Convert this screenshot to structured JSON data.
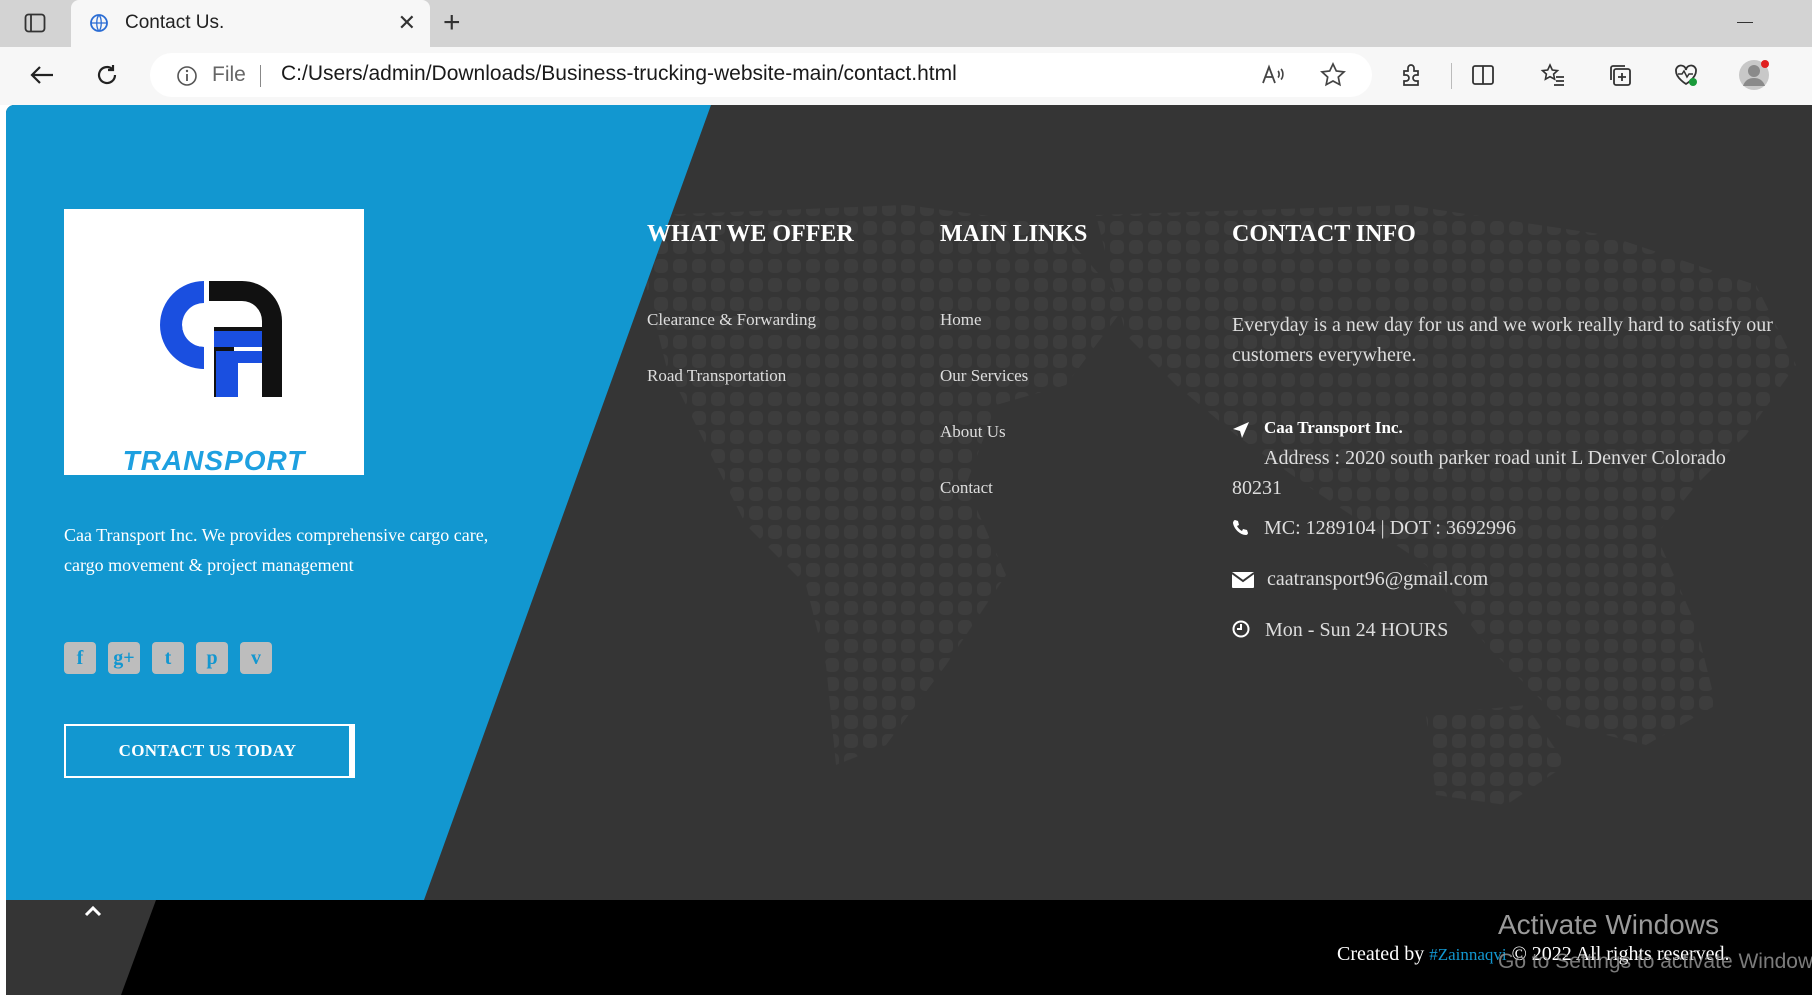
{
  "browser": {
    "tab_title": "Contact Us.",
    "address_scheme": "File",
    "address_url": "C:/Users/admin/Downloads/Business-trucking-website-main/contact.html"
  },
  "logo": {
    "letters": "CAA",
    "wordmark": "TRANSPORT"
  },
  "about": {
    "text": "Caa Transport Inc. We provides comprehensive cargo care, cargo movement & project management"
  },
  "socials": [
    {
      "icon": "facebook-icon",
      "glyph": "f"
    },
    {
      "icon": "google-plus-icon",
      "glyph": "g+"
    },
    {
      "icon": "twitter-icon",
      "glyph": "t"
    },
    {
      "icon": "pinterest-icon",
      "glyph": "p"
    },
    {
      "icon": "vimeo-icon",
      "glyph": "v"
    }
  ],
  "cta": {
    "label": "CONTACT US TODAY"
  },
  "offer": {
    "heading": "WHAT WE OFFER",
    "links": [
      "Clearance & Forwarding",
      "Road Transportation"
    ]
  },
  "main_links": {
    "heading": "MAIN LINKS",
    "links": [
      "Home",
      "Our Services",
      "About Us",
      "Contact"
    ]
  },
  "contact_info": {
    "heading": "CONTACT INFO",
    "intro": "Everyday is a new day for us and we work really hard to satisfy our customers everywhere.",
    "company": "Caa Transport Inc.",
    "address": "Address : 2020 south parker road unit L Denver Colorado 80231",
    "license": "MC: 1289104 | DOT : 3692996",
    "email": "caatransport96@gmail.com",
    "hours": "Mon - Sun 24 HOURS"
  },
  "footer": {
    "created_by": "Created by",
    "author": "#Zainnaqvi",
    "copyright": "© 2022 All rights reserved."
  },
  "watermark": {
    "title": "Activate Windows",
    "subtitle": "Go to Settings to activate Windows."
  },
  "colors": {
    "brand_blue": "#1297d0",
    "dark_bg": "#353535",
    "footer_bg": "#000000"
  }
}
